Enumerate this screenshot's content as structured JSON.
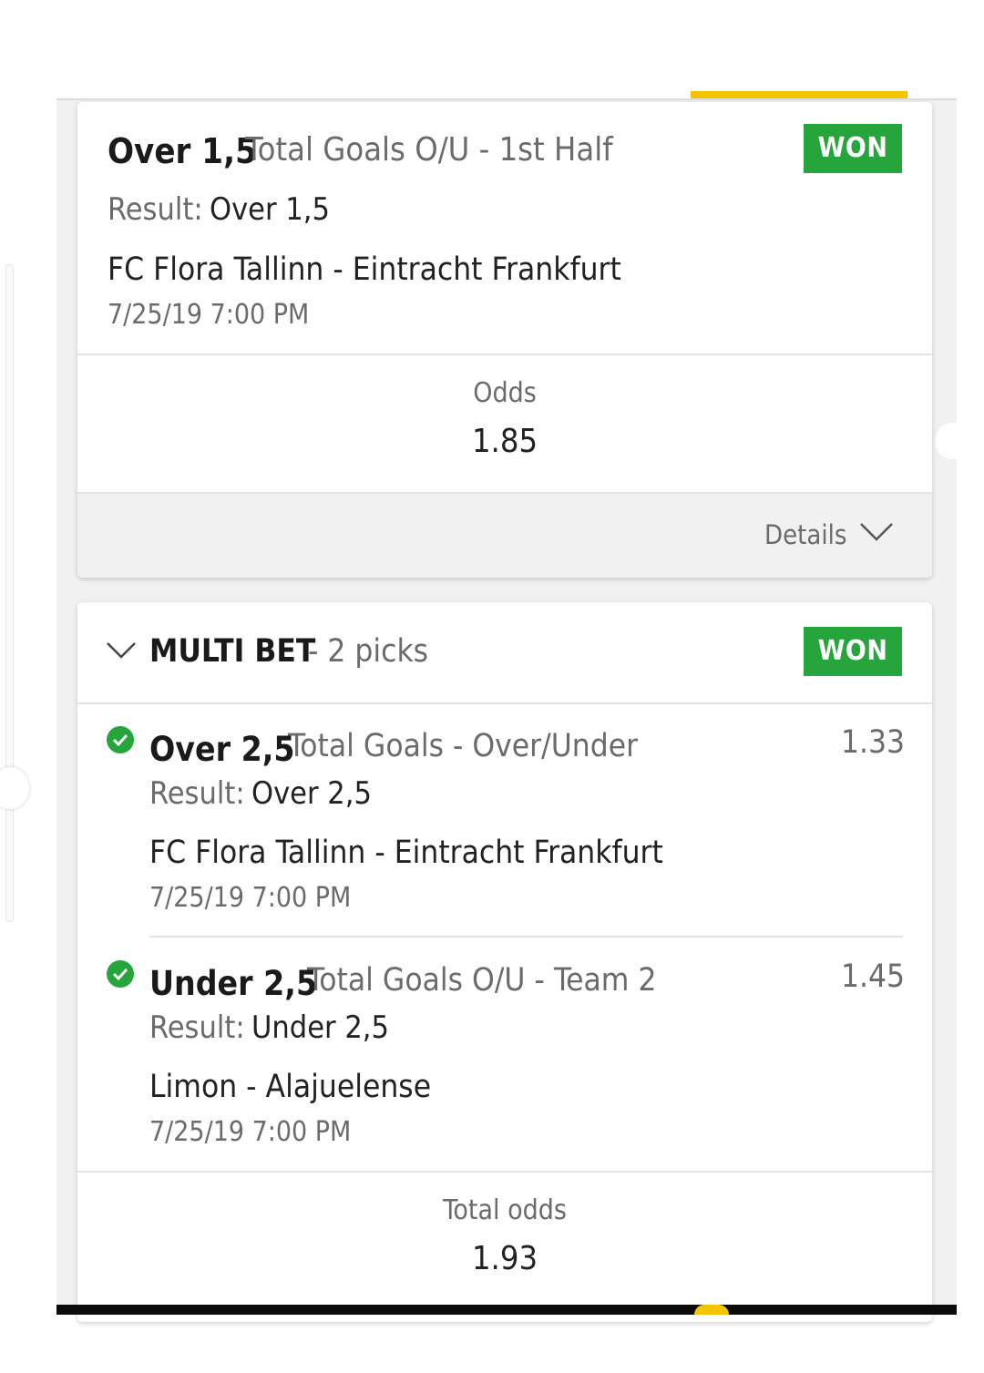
{
  "single_bet": {
    "selection": "Over 1,5",
    "market": "Total Goals O/U - 1st Half",
    "status": "WON",
    "result_label": "Result:",
    "result_value": "Over 1,5",
    "match": "FC Flora Tallinn - Eintracht Frankfurt",
    "datetime": "7/25/19 7:00 PM",
    "odds_label": "Odds",
    "odds_value": "1.85",
    "details_label": "Details"
  },
  "multi_bet": {
    "title": "MULTI BET",
    "picks_text": "- 2 picks",
    "status": "WON",
    "picks": [
      {
        "selection": "Over 2,5",
        "market": "Total Goals - Over/Under",
        "odds": "1.33",
        "result_label": "Result:",
        "result_value": "Over 2,5",
        "match": "FC Flora Tallinn - Eintracht Frankfurt",
        "datetime": "7/25/19 7:00 PM"
      },
      {
        "selection": "Under 2,5",
        "market": "Total Goals O/U - Team 2",
        "odds": "1.45",
        "result_label": "Result:",
        "result_value": "Under 2,5",
        "match": "Limon - Alajuelense",
        "datetime": "7/25/19 7:00 PM"
      }
    ],
    "total_odds_label": "Total odds",
    "total_odds_value": "1.93"
  },
  "colors": {
    "won_green": "#25a53b",
    "accent_yellow": "#f2c500"
  }
}
